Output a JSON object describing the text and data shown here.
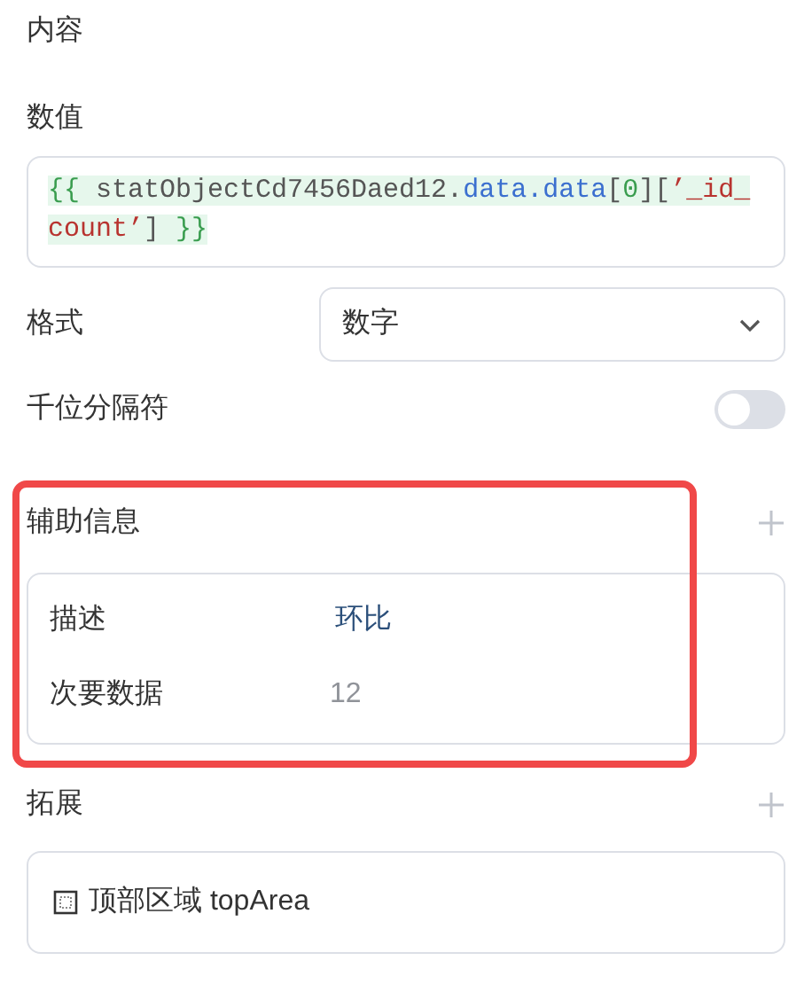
{
  "section_title": "内容",
  "value_field": {
    "label": "数值",
    "tokens": [
      {
        "kind": "brace",
        "text": "{{ "
      },
      {
        "kind": "ident",
        "text": "statObjectCd7456Daed12."
      },
      {
        "kind": "prop",
        "text": "data.data"
      },
      {
        "kind": "punct",
        "text": "["
      },
      {
        "kind": "number",
        "text": "0"
      },
      {
        "kind": "punct",
        "text": "]["
      },
      {
        "kind": "string",
        "text": "’_id_count’"
      },
      {
        "kind": "punct",
        "text": "] "
      },
      {
        "kind": "brace",
        "text": "}}"
      }
    ]
  },
  "format": {
    "label": "格式",
    "value": "数字"
  },
  "thousands_separator": {
    "label": "千位分隔符",
    "on": false
  },
  "aux_info": {
    "title": "辅助信息",
    "highlighted": true,
    "rows": [
      {
        "label": "描述",
        "value": "环比",
        "kind": "text"
      },
      {
        "label": "次要数据",
        "value": "12",
        "kind": "number"
      }
    ]
  },
  "extension": {
    "title": "拓展",
    "items": [
      {
        "label": "顶部区域 topArea"
      }
    ]
  }
}
